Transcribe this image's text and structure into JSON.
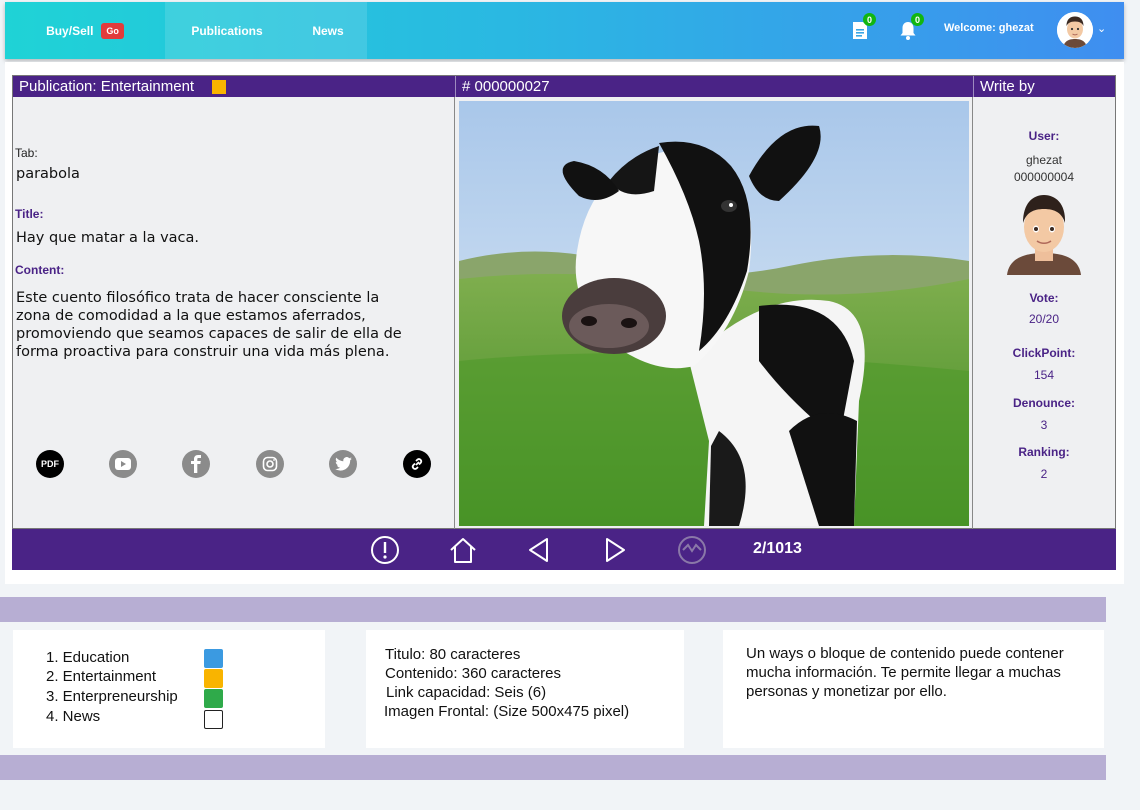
{
  "nav": {
    "buysell": "Buy/Sell",
    "go_badge": "Go",
    "publications": "Publications",
    "news": "News",
    "doc_count": "0",
    "bell_count": "0",
    "welcome": "Welcome: ghezat"
  },
  "publication": {
    "header_label": "Publication: Entertainment",
    "number": "# 000000027",
    "write_by": "Write by",
    "tab_label": "Tab:",
    "tab_value": "parabola",
    "title_label": "Title:",
    "title_value": "Hay que matar a la vaca.",
    "content_label": "Content:",
    "content_value": "Este cuento filosófico trata de hacer consciente la zona de comodidad a la que estamos aferrados, promoviendo que seamos capaces de salir de ella de forma proactiva para construir una vida más plena.",
    "pdf_label": "PDF"
  },
  "author": {
    "user_label": "User:",
    "username": "ghezat",
    "user_id": "000000004",
    "vote_label": "Vote:",
    "vote_value": "20/20",
    "clickpoint_label": "ClickPoint:",
    "clickpoint_value": "154",
    "denounce_label": "Denounce:",
    "denounce_value": "3",
    "ranking_label": "Ranking:",
    "ranking_value": "2"
  },
  "pager": {
    "counter": "2/1013"
  },
  "legend": {
    "items": [
      {
        "label": "1. Education",
        "color": "#3b9ae1"
      },
      {
        "label": "2. Entertainment",
        "color": "#f9b400"
      },
      {
        "label": "3. Enterpreneurship",
        "color": "#2faa4a"
      },
      {
        "label": "4. News",
        "color": "#ffffff"
      }
    ]
  },
  "specs": {
    "line1": "Titulo: 80 caracteres",
    "line2": "Contenido: 360 caracteres",
    "line3": "Link capacidad: Seis (6)",
    "line4": "Imagen Frontal:  (Size 500x475 pixel)"
  },
  "description": "Un ways o bloque de contenido puede contener mucha información. Te permite llegar a muchas personas y monetizar por ello.",
  "colors": {
    "primary_purple": "#4a2386",
    "band": "#b7aed3"
  }
}
